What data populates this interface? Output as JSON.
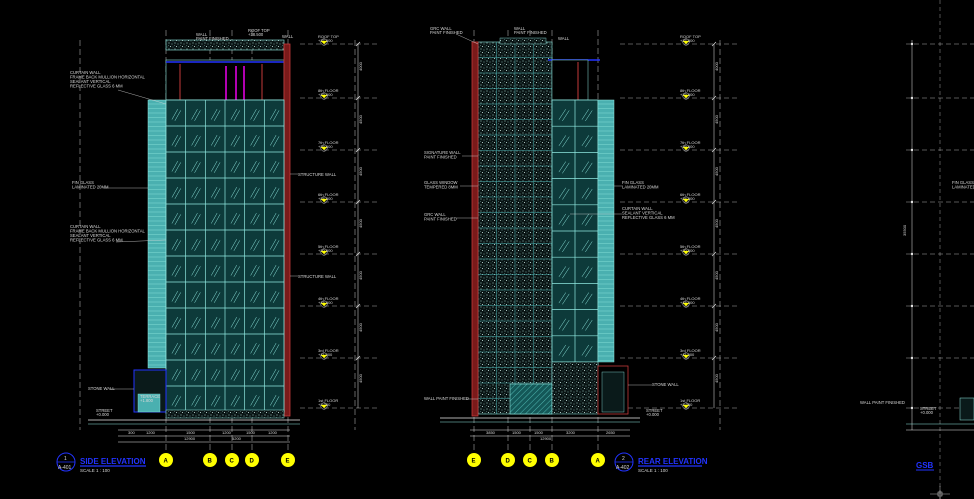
{
  "drawing": {
    "background": "#000000",
    "colors": {
      "glass": "#4ab0b0",
      "mullion": "#8fe8e0",
      "wall": "#c43a3a",
      "stone": "#9ad4cc",
      "dim": "#e8e8e8",
      "grid_bubble": "#ffff00",
      "title": "#2233ff",
      "accent": "#ff00ff"
    },
    "elevations": [
      {
        "id": "left",
        "title": "SIDE ELEVATION",
        "number": "1",
        "sheet": "A-401",
        "scale": "SCALE 1 : 100",
        "grid_bubbles": [
          "A",
          "B",
          "C",
          "D",
          "E"
        ],
        "dims_top": [
          "300",
          "1200",
          "1500",
          "1200",
          "1500",
          "1200"
        ],
        "dims_bottom": [
          "12900",
          "5200"
        ],
        "notes_left": [
          {
            "text": "CURTAIN WALL\nFRAME BACK MULLION HORIZONTAL\nSEALANT VERTICAL\nREFLECTIVE GLASS 6 MM"
          },
          {
            "text": "FIN GLASS\nLAMINATED 20MM"
          },
          {
            "text": "CURTAIN WALL\nFRAME BACK MULLION HORIZONTAL\nSEALANT VERTICAL\nREFLECTIVE GLASS 6 MM"
          },
          {
            "text": "STONE WALL"
          },
          {
            "text": "TERRACE\n+1.800"
          },
          {
            "text": "STREET\n+0.000"
          }
        ],
        "notes_right": [
          {
            "text": "STRUCTURE WALL"
          },
          {
            "text": "STRUCTURE WALL"
          }
        ],
        "top_notes": [
          {
            "text": "WALL\nPAINT FINISHED"
          },
          {
            "text": "ROOF TOP\n+38.500"
          },
          {
            "text": "WALL"
          }
        ],
        "levels": [
          {
            "name": "ROOF TOP",
            "elev": "+37.500"
          },
          {
            "name": "8th FLOOR",
            "elev": "+33.500"
          },
          {
            "name": "7th FLOOR",
            "elev": "+29.000"
          },
          {
            "name": "6th FLOOR",
            "elev": "+24.500"
          },
          {
            "name": "5th FLOOR",
            "elev": "+20.000"
          },
          {
            "name": "4th FLOOR",
            "elev": "+15.500"
          },
          {
            "name": "3rd FLOOR",
            "elev": "+11.000"
          },
          {
            "name": "2nd FLOOR",
            "elev": "+6.500"
          },
          {
            "name": "1st FLOOR",
            "elev": "+2.000"
          }
        ],
        "level_dims": [
          "4000",
          "4500",
          "4500",
          "4500",
          "4500",
          "4500",
          "4500",
          "4500"
        ]
      },
      {
        "id": "middle",
        "title": "REAR ELEVATION",
        "number": "2",
        "sheet": "A-402",
        "scale": "SCALE 1 : 100",
        "grid_bubbles": [
          "E",
          "D",
          "C",
          "B",
          "A"
        ],
        "dims_top": [
          "3850",
          "1500",
          "1500",
          "3200",
          "2650"
        ],
        "dims_bottom": [
          "12900"
        ],
        "notes_left": [
          {
            "text": "SIGNATURE WALL\nPAINT FINISHED"
          },
          {
            "text": "GLASS WINDOW\nTEMPERED 8MM"
          },
          {
            "text": "GRC WALL\nPAINT FINISHED"
          },
          {
            "text": "WALL PAINT FINISHED"
          }
        ],
        "notes_right": [
          {
            "text": "FIN GLASS\nLAMINATED 20MM"
          },
          {
            "text": "CURTAIN WALL\nSEALANT VERTICAL\nREFLECTIVE GLASS 6 MM"
          },
          {
            "text": "STONE WALL"
          },
          {
            "text": "STREET\n+0.000"
          }
        ],
        "top_notes": [
          {
            "text": "GRC WALL\nPAINT FINISHED"
          },
          {
            "text": "WALL\nPAINT FINISHED"
          },
          {
            "text": "WALL"
          }
        ],
        "levels": [
          {
            "name": "ROOF TOP",
            "elev": "+37.500"
          },
          {
            "name": "8th FLOOR",
            "elev": "+33.500"
          },
          {
            "name": "7th FLOOR",
            "elev": "+29.000"
          },
          {
            "name": "6th FLOOR",
            "elev": "+24.500"
          },
          {
            "name": "5th FLOOR",
            "elev": "+20.000"
          },
          {
            "name": "4th FLOOR",
            "elev": "+15.500"
          },
          {
            "name": "3rd FLOOR",
            "elev": "+11.000"
          },
          {
            "name": "2nd FLOOR",
            "elev": "+6.500"
          },
          {
            "name": "1st FLOOR",
            "elev": "+2.000"
          }
        ],
        "level_dims": [
          "4000",
          "4500",
          "4500",
          "4500",
          "4500",
          "4500",
          "4500",
          "4500"
        ]
      },
      {
        "id": "right",
        "title": "GSB",
        "notes": [
          {
            "text": "WALL PAINT FINISHED"
          },
          {
            "text": "STREET\n+0.000"
          },
          {
            "text": "FIN GLASS\nLAMINATED"
          }
        ],
        "level_dim": "35500"
      }
    ]
  }
}
